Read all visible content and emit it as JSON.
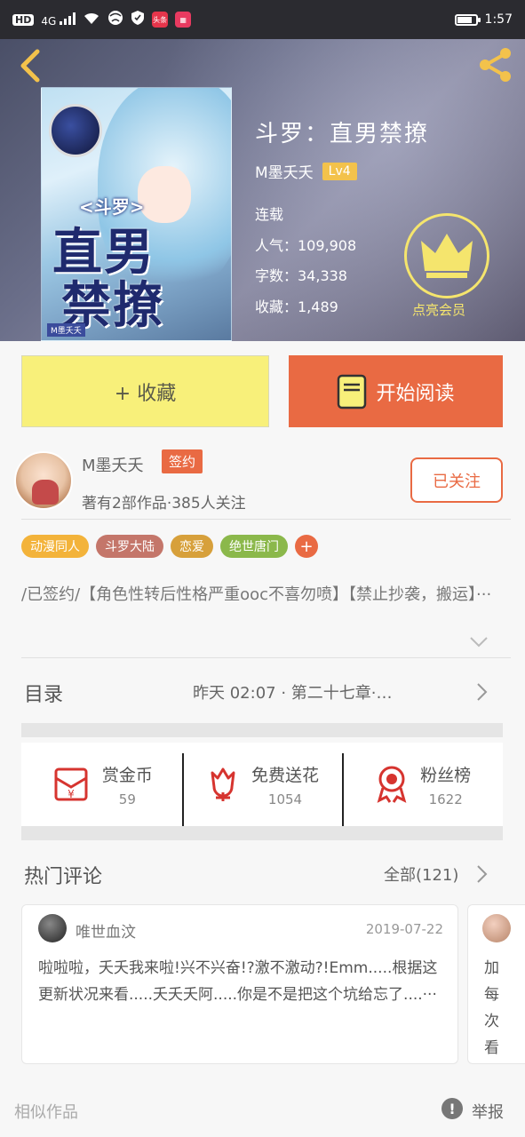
{
  "status_bar": {
    "network": "HD",
    "signal": "4G",
    "app_badge": "头条",
    "time": "1:57"
  },
  "book": {
    "title": "斗罗：直男禁撩",
    "author": "M墨夭夭",
    "level": "Lv4",
    "status": "连载",
    "popularity": "人气：109,908",
    "word_count": "字数：34,338",
    "favorites": "收藏：1,489",
    "cover_sub": "<斗罗>",
    "cover_big1": "直男",
    "cover_big2": "禁撩",
    "cover_badge": "M墨夭夭"
  },
  "vip": {
    "label": "点亮会员"
  },
  "actions": {
    "favorite": "+ 收藏",
    "read": "开始阅读"
  },
  "author_card": {
    "name": "M墨夭夭",
    "sign_tag": "签约",
    "meta": "著有2部作品·385人关注",
    "follow": "已关注"
  },
  "tags": [
    {
      "label": "动漫同人",
      "color": "#f3b33a"
    },
    {
      "label": "斗罗大陆",
      "color": "#c4766a"
    },
    {
      "label": "恋爱",
      "color": "#d7a03b"
    },
    {
      "label": "绝世唐门",
      "color": "#8bb84b"
    }
  ],
  "tag_more": "+",
  "description": "/已签约/【角色性转后性格严重ooc不喜勿喷】【禁止抄袭，搬运】···",
  "catalog": {
    "label": "目录",
    "latest": "昨天 02:07 · 第二十七章·…"
  },
  "stats": [
    {
      "label": "赏金币",
      "value": "59",
      "icon": "red-envelope-icon"
    },
    {
      "label": "免费送花",
      "value": "1054",
      "icon": "flower-icon"
    },
    {
      "label": "粉丝榜",
      "value": "1622",
      "icon": "medal-icon"
    }
  ],
  "comments": {
    "title": "热门评论",
    "all": "全部(121)",
    "items": [
      {
        "user": "唯世血汶",
        "date": "2019-07-22",
        "text": "啦啦啦，夭夭我来啦!兴不兴奋!?激不激动?!Emm.....根据这更新状况来看.....夭夭夭阿.....你是不是把这个坑给忘了....···"
      },
      {
        "text": "加每次看"
      }
    ]
  },
  "footer": {
    "similar": "相似作品",
    "report": "举报"
  },
  "colors": {
    "accent": "#e96a43",
    "favorite_bg": "#f8f07a",
    "vip": "#f5e56d"
  }
}
